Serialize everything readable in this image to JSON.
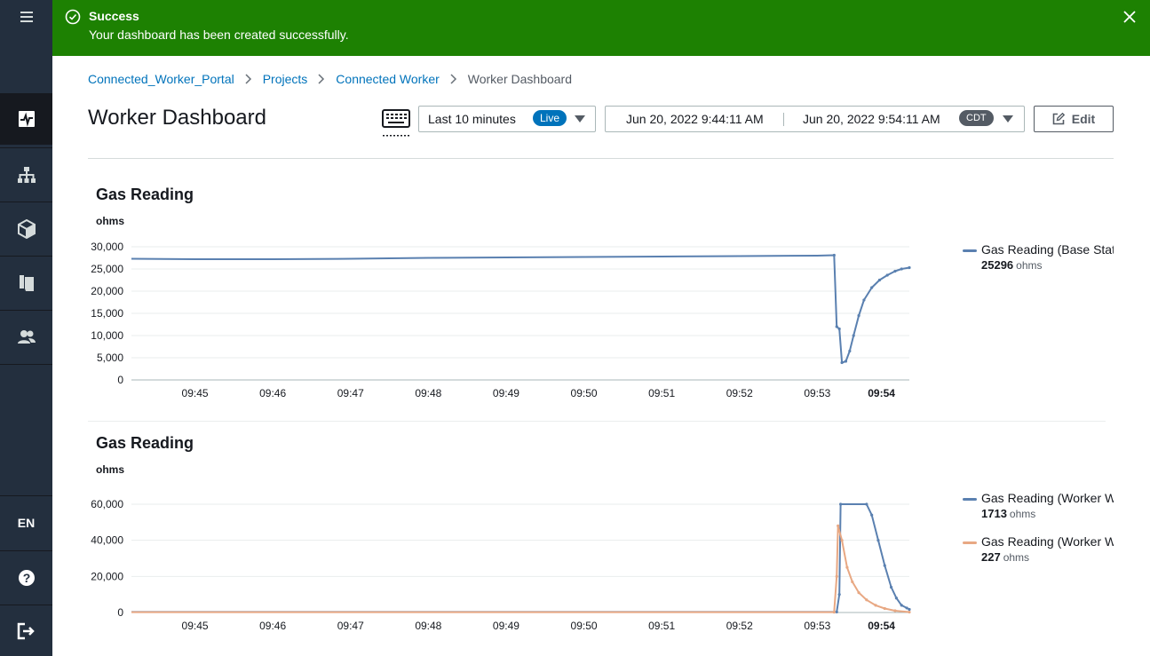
{
  "flash": {
    "title": "Success",
    "message": "Your dashboard has been created successfully.",
    "color": "#1d8102"
  },
  "sidebar": {
    "items": [
      {
        "icon": "menu-icon"
      },
      {
        "icon": "dashboard-icon",
        "active": true
      },
      {
        "icon": "hierarchy-icon"
      },
      {
        "icon": "cube-icon"
      },
      {
        "icon": "book-icon"
      },
      {
        "icon": "users-icon"
      }
    ],
    "language": "EN",
    "bottom": [
      {
        "icon": "help-icon"
      },
      {
        "icon": "sign-out-icon"
      }
    ]
  },
  "breadcrumb": {
    "items": [
      "Connected_Worker_Portal",
      "Projects",
      "Connected Worker"
    ],
    "current": "Worker Dashboard"
  },
  "header": {
    "title": "Worker Dashboard",
    "range_label": "Last 10 minutes",
    "live_badge": "Live",
    "start_time": "Jun 20, 2022 9:44:11 AM",
    "end_time": "Jun 20, 2022 9:54:11 AM",
    "timezone": "CDT",
    "edit_label": "Edit"
  },
  "x_ticks": [
    "09:45",
    "09:46",
    "09:47",
    "09:48",
    "09:49",
    "09:50",
    "09:51",
    "09:52",
    "09:53",
    "09:54"
  ],
  "chart_data": [
    {
      "type": "line",
      "title": "Gas Reading",
      "ylabel": "ohms",
      "y_ticks": [
        0,
        5000,
        10000,
        15000,
        20000,
        25000,
        30000
      ],
      "y_tick_labels": [
        "0",
        "5,000",
        "10,000",
        "15,000",
        "20,000",
        "25,000",
        "30,000"
      ],
      "ylim": [
        0,
        30000
      ],
      "x_range_minutes": [
        "09:44:11",
        "09:54:11"
      ],
      "series": [
        {
          "name": "Gas Reading (Base Stati",
          "color": "#5a80b0",
          "latest_value": "25296",
          "unit": "ohms",
          "points": [
            [
              "09:44:11",
              27300
            ],
            [
              "09:45:00",
              27200
            ],
            [
              "09:46:00",
              27200
            ],
            [
              "09:47:00",
              27300
            ],
            [
              "09:48:00",
              27500
            ],
            [
              "09:49:00",
              27600
            ],
            [
              "09:50:00",
              27700
            ],
            [
              "09:51:00",
              27800
            ],
            [
              "09:52:00",
              27900
            ],
            [
              "09:53:00",
              28000
            ],
            [
              "09:53:13",
              28100
            ],
            [
              "09:53:15",
              12000
            ],
            [
              "09:53:17",
              11500
            ],
            [
              "09:53:19",
              3900
            ],
            [
              "09:53:22",
              4200
            ],
            [
              "09:53:25",
              6500
            ],
            [
              "09:53:28",
              10000
            ],
            [
              "09:53:32",
              14500
            ],
            [
              "09:53:36",
              18000
            ],
            [
              "09:53:42",
              20800
            ],
            [
              "09:53:48",
              22500
            ],
            [
              "09:53:54",
              23600
            ],
            [
              "09:54:00",
              24500
            ],
            [
              "09:54:05",
              25000
            ],
            [
              "09:54:11",
              25300
            ]
          ]
        }
      ]
    },
    {
      "type": "line",
      "title": "Gas Reading",
      "ylabel": "ohms",
      "y_ticks": [
        0,
        20000,
        40000,
        60000
      ],
      "y_tick_labels": [
        "0",
        "20,000",
        "40,000",
        "60,000"
      ],
      "ylim": [
        0,
        62000
      ],
      "x_range_minutes": [
        "09:44:11",
        "09:54:11"
      ],
      "series": [
        {
          "name": "Gas Reading (Worker W",
          "color": "#5a80b0",
          "latest_value": "1713",
          "unit": "ohms",
          "points": [
            [
              "09:44:11",
              300
            ],
            [
              "09:53:00",
              300
            ],
            [
              "09:53:15",
              300
            ],
            [
              "09:53:17",
              10000
            ],
            [
              "09:53:18",
              60000
            ],
            [
              "09:53:38",
              60000
            ],
            [
              "09:53:42",
              54000
            ],
            [
              "09:53:47",
              40000
            ],
            [
              "09:53:52",
              26000
            ],
            [
              "09:53:57",
              14000
            ],
            [
              "09:54:01",
              8000
            ],
            [
              "09:54:05",
              4000
            ],
            [
              "09:54:09",
              2500
            ],
            [
              "09:54:11",
              1713
            ]
          ]
        },
        {
          "name": "Gas Reading (Worker W",
          "color": "#e8a883",
          "latest_value": "227",
          "unit": "ohms",
          "points": [
            [
              "09:44:11",
              200
            ],
            [
              "09:53:00",
              200
            ],
            [
              "09:53:13",
              200
            ],
            [
              "09:53:15",
              20000
            ],
            [
              "09:53:16",
              48000
            ],
            [
              "09:53:19",
              40000
            ],
            [
              "09:53:23",
              25000
            ],
            [
              "09:53:27",
              17000
            ],
            [
              "09:53:32",
              11000
            ],
            [
              "09:53:38",
              7000
            ],
            [
              "09:53:45",
              4000
            ],
            [
              "09:53:52",
              2200
            ],
            [
              "09:54:00",
              1000
            ],
            [
              "09:54:11",
              227
            ]
          ]
        }
      ]
    }
  ]
}
